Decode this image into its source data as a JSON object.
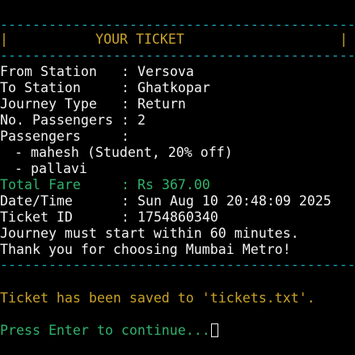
{
  "terminal": {
    "border": "---------------------------------------------",
    "header_left": "|",
    "header_title": "YOUR TICKET",
    "header_right": "|",
    "from_label": "From Station",
    "from_value": "Versova",
    "to_label": "To Station",
    "to_value": "Ghatkopar",
    "journey_label": "Journey Type",
    "journey_value": "Return",
    "pcount_label": "No. Passengers",
    "pcount_value": "2",
    "passengers_label": "Passengers",
    "passengers": [
      "- mahesh (Student, 20% off)",
      "- pallavi"
    ],
    "fare_label": "Total Fare",
    "fare_value": "Rs 367.00",
    "datetime_label": "Date/Time",
    "datetime_value": "Sun Aug 10 20:48:09 2025",
    "ticketid_label": "Ticket ID",
    "ticketid_value": "1754860340",
    "note_line": "Journey must start within 60 minutes.",
    "thanks_line": "Thank you for choosing Mumbai Metro!",
    "saved_message": "Ticket has been saved to 'tickets.txt'.",
    "continue_prompt": "Press Enter to continue..."
  },
  "colors": {
    "background": "#000000",
    "border": "#1aa2b8",
    "header": "#c9a227",
    "text": "#f2f2f2",
    "fare": "#2fb36b",
    "saved": "#c9a227",
    "prompt": "#2fb36b"
  }
}
